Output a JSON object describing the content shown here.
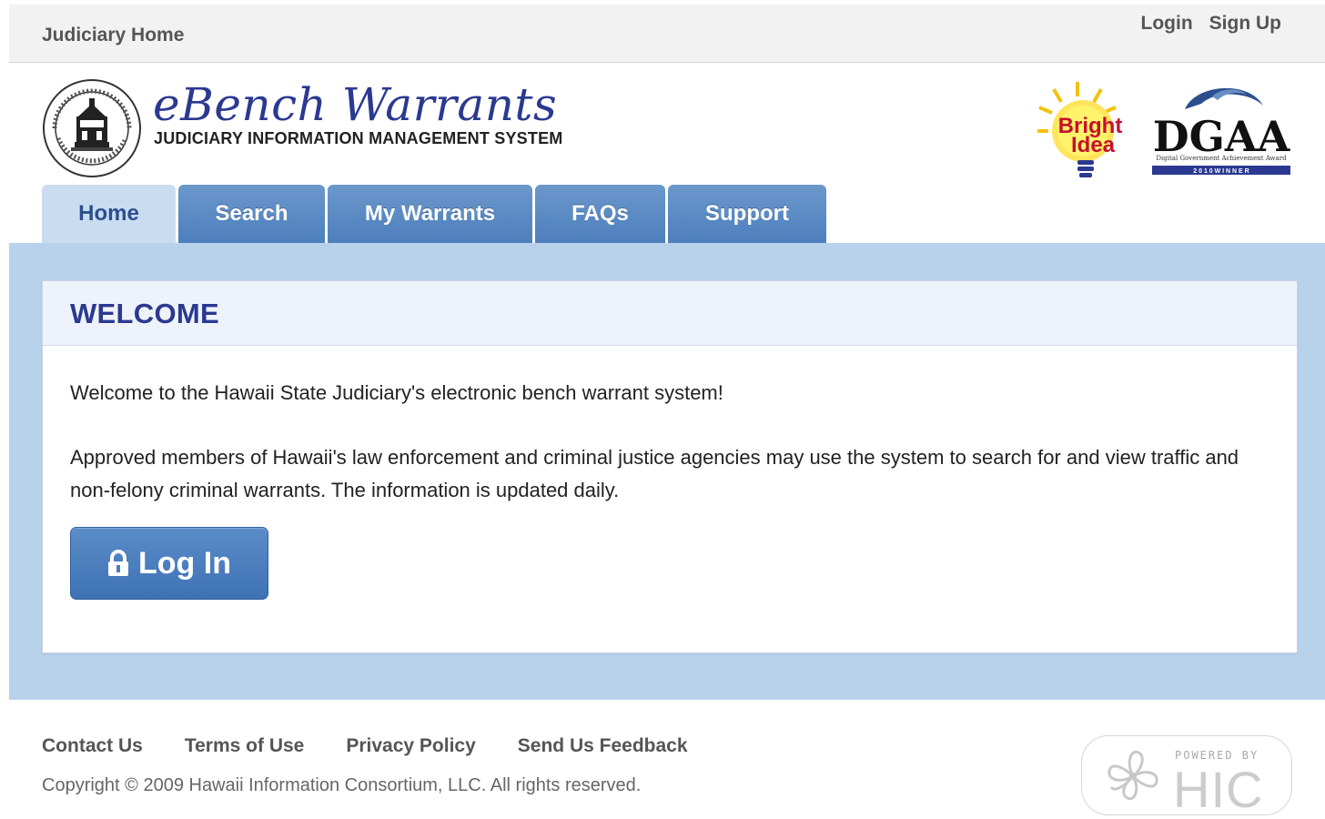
{
  "topbar": {
    "home_link": "Judiciary Home",
    "login": "Login",
    "signup": "Sign Up"
  },
  "header": {
    "title": "eBench Warrants",
    "subtitle": "JUDICIARY INFORMATION MANAGEMENT SYSTEM",
    "seal_icon": "state-judiciary-seal-icon",
    "bright_idea_logo": {
      "line1": "Bright",
      "line2": "Idea"
    },
    "dgaa_logo": {
      "name": "DGAA",
      "tagline": "Digital Government Achievement Award",
      "banner": "2 0 1 0   W I N N E R"
    }
  },
  "tabs": [
    {
      "label": "Home",
      "active": true
    },
    {
      "label": "Search",
      "active": false
    },
    {
      "label": "My Warrants",
      "active": false
    },
    {
      "label": "FAQs",
      "active": false
    },
    {
      "label": "Support",
      "active": false
    }
  ],
  "welcome": {
    "title": "WELCOME",
    "paragraph1": "Welcome to the Hawaii State Judiciary's electronic bench warrant system!",
    "paragraph2": "Approved members of Hawaii's law enforcement and criminal justice agencies may use the system to search for and view traffic and non-felony criminal warrants. The information is updated daily.",
    "login_button": "Log In",
    "login_icon": "lock-icon"
  },
  "footer": {
    "links": [
      "Contact Us",
      "Terms of Use",
      "Privacy Policy",
      "Send Us Feedback"
    ],
    "copyright": "Copyright © 2009 Hawaii Information Consortium, LLC. All rights reserved.",
    "powered_by": "POWERED BY",
    "powered_name": "HIC"
  },
  "colors": {
    "brand_blue": "#2b3990",
    "tab_blue": "#4d7fbc",
    "tab_active": "#c9dcf0",
    "band": "#b9d2ec",
    "button": "#3f72b4"
  }
}
